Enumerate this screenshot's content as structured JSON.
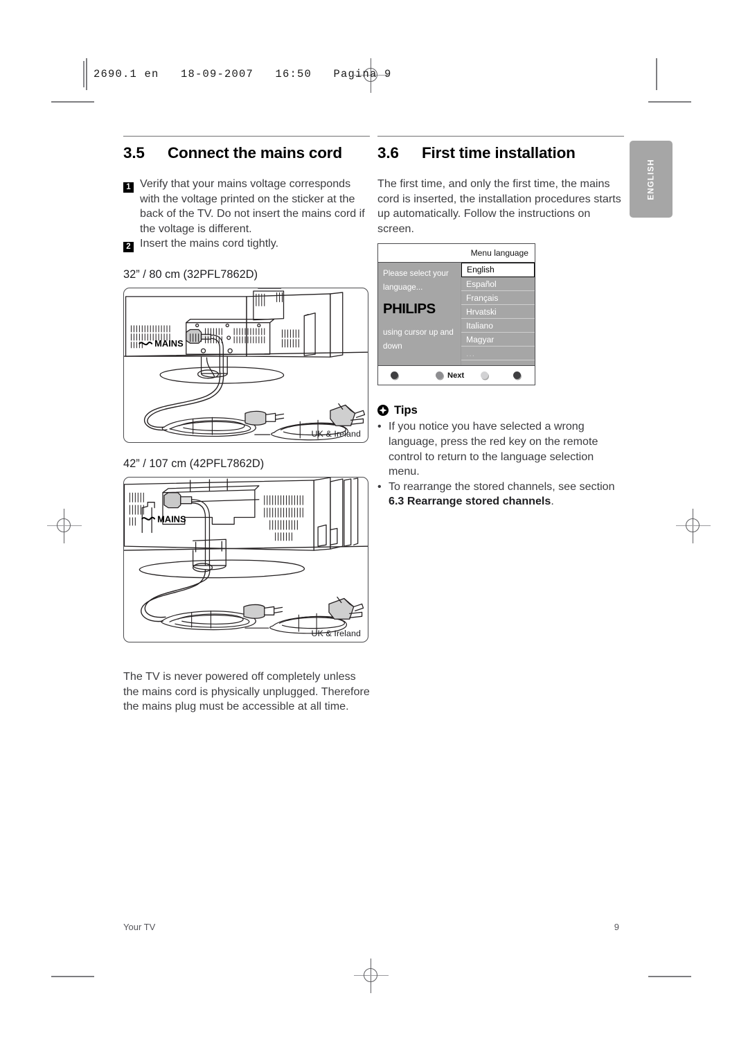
{
  "prepress": {
    "header_text": "2690.1 en   18-09-2007   16:50   Pagina 9"
  },
  "side_tab": {
    "label": "ENGLISH"
  },
  "sections": {
    "left": {
      "number": "3.5",
      "title": "Connect the mains cord",
      "steps": [
        {
          "num": "1",
          "text": "Verify that your mains voltage corresponds with the voltage printed on the sticker at the back of the TV. Do not insert the mains cord if the voltage is different."
        },
        {
          "num": "2",
          "text": "Insert the mains cord tightly."
        }
      ],
      "figures": [
        {
          "label": "32” / 80 cm (32PFL7862D)",
          "caption": "UK & Ireland",
          "mains_label": "MAINS"
        },
        {
          "label": "42” / 107 cm (42PFL7862D)",
          "caption": "UK & Ireland",
          "mains_label": "MAINS"
        }
      ],
      "closing_paragraph": "The TV is never powered off completely unless the mains cord is physically unplugged. Therefore the mains plug must be accessible at all time."
    },
    "right": {
      "number": "3.6",
      "title": "First time installation",
      "intro": "The first time, and only the first time, the mains cord is inserted, the installation procedures starts up automatically. Follow the instructions on screen.",
      "tv_menu": {
        "title": "Menu language",
        "prompt_line1": "Please select your",
        "prompt_line2": "language...",
        "brand": "PHILIPS",
        "hint_line1": "using cursor up and",
        "hint_line2": "down",
        "languages": [
          {
            "name": "English",
            "selected": true
          },
          {
            "name": "Español",
            "selected": false
          },
          {
            "name": "Français",
            "selected": false
          },
          {
            "name": "Hrvatski",
            "selected": false
          },
          {
            "name": "Italiano",
            "selected": false
          },
          {
            "name": "Magyar",
            "selected": false
          },
          {
            "name": "...",
            "selected": false
          }
        ],
        "buttons": [
          {
            "label": "",
            "color": "#3f3f42"
          },
          {
            "label": "Next",
            "color": "#8e8e91"
          },
          {
            "label": "",
            "color": "#d2d2d4"
          },
          {
            "label": "",
            "color": "#3f3f42"
          }
        ]
      },
      "tips": {
        "title": "Tips",
        "icon": "plus-circle-icon",
        "items": [
          {
            "text_plain": "If you notice you have selected a wrong language, press the red key on the remote control to return to the language selection menu.",
            "bold_tail": ""
          },
          {
            "text_plain": "To rearrange the stored channels, see section ",
            "bold_tail": "6.3 Rearrange stored channels",
            "text_end": "."
          }
        ]
      }
    }
  },
  "footer": {
    "left_label": "Your TV",
    "page_number": "9"
  }
}
